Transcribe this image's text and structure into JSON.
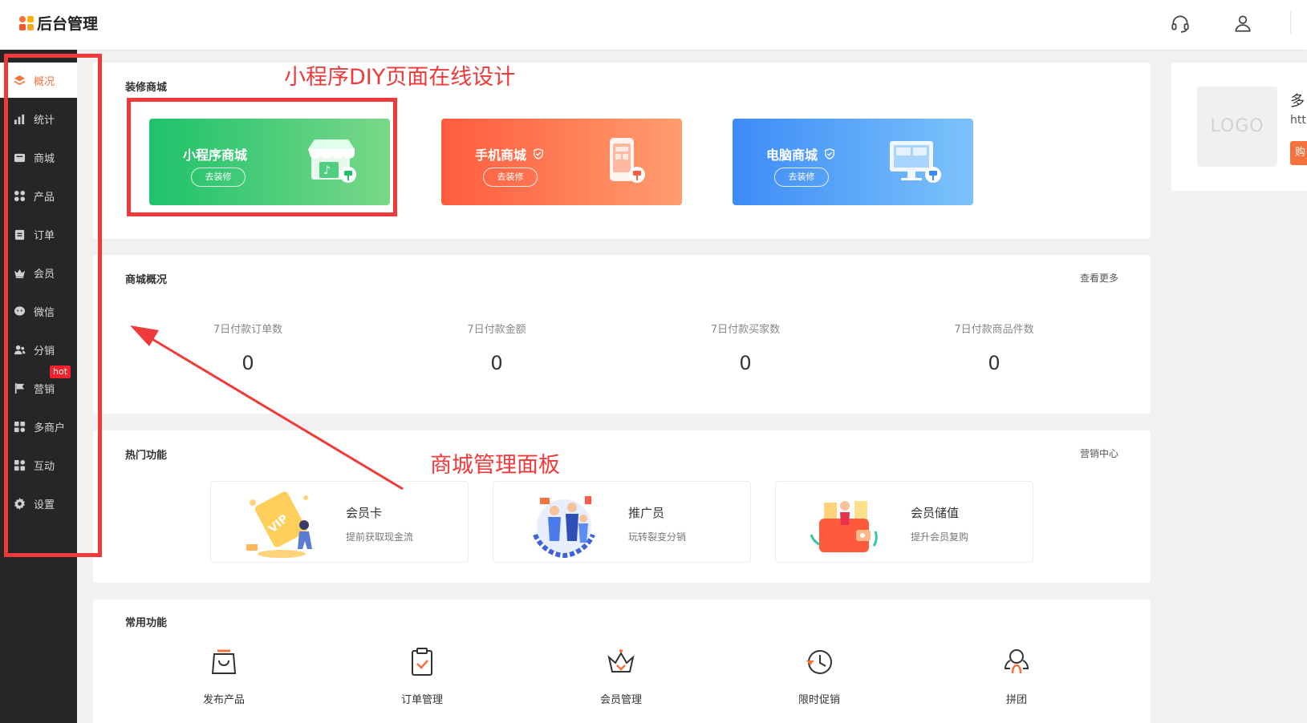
{
  "header": {
    "title": "后台管理",
    "logo_colors": [
      "#f5723c",
      "#f5a623",
      "#f05a28",
      "#ffb000"
    ],
    "icons": [
      "headset-icon",
      "user-icon"
    ]
  },
  "sidebar": {
    "items": [
      {
        "label": "概况",
        "icon": "layers-icon",
        "active": true
      },
      {
        "label": "统计",
        "icon": "bar-chart-icon"
      },
      {
        "label": "商城",
        "icon": "store-icon"
      },
      {
        "label": "产品",
        "icon": "grid-icon"
      },
      {
        "label": "订单",
        "icon": "clipboard-icon"
      },
      {
        "label": "会员",
        "icon": "crown-icon"
      },
      {
        "label": "微信",
        "icon": "chat-icon"
      },
      {
        "label": "分销",
        "icon": "users-icon"
      },
      {
        "label": "营销",
        "icon": "flag-icon"
      },
      {
        "label": "多商户",
        "icon": "merchant-icon"
      },
      {
        "label": "互动",
        "icon": "interact-icon"
      },
      {
        "label": "设置",
        "icon": "gear-icon"
      }
    ],
    "hot_badge": "hot",
    "active_color": "#f5723c"
  },
  "decorate": {
    "title": "装修商城",
    "cards": [
      {
        "name": "小程序商城",
        "button": "去装修",
        "verified": false,
        "gradient": [
          "#1ec26a",
          "#7ad88a"
        ]
      },
      {
        "name": "手机商城",
        "button": "去装修",
        "verified": true,
        "gradient": [
          "#ff5b3e",
          "#ff9d6e"
        ]
      },
      {
        "name": "电脑商城",
        "button": "去装修",
        "verified": true,
        "gradient": [
          "#3d8bf7",
          "#7cc3fb"
        ]
      }
    ]
  },
  "overview": {
    "title": "商城概况",
    "more": "查看更多",
    "stats": [
      {
        "label": "7日付款订单数",
        "value": "0"
      },
      {
        "label": "7日付款金额",
        "value": "0"
      },
      {
        "label": "7日付款买家数",
        "value": "0"
      },
      {
        "label": "7日付款商品件数",
        "value": "0"
      }
    ]
  },
  "hot": {
    "title": "热门功能",
    "more": "营销中心",
    "cards": [
      {
        "name": "会员卡",
        "desc": "提前获取现金流"
      },
      {
        "name": "推广员",
        "desc": "玩转裂变分销"
      },
      {
        "name": "会员储值",
        "desc": "提升会员复购"
      }
    ]
  },
  "common": {
    "title": "常用功能",
    "items": [
      {
        "label": "发布产品",
        "icon": "shopping-bag-icon"
      },
      {
        "label": "订单管理",
        "icon": "order-check-icon"
      },
      {
        "label": "会员管理",
        "icon": "crown-icon"
      },
      {
        "label": "限时促销",
        "icon": "clock-icon"
      },
      {
        "label": "拼团",
        "icon": "group-icon"
      }
    ]
  },
  "shop": {
    "logo_text": "LOGO",
    "name_partial": "多",
    "url_partial": "http",
    "button_partial": "购"
  },
  "annotations": {
    "top_label": "小程序DIY页面在线设计",
    "mid_label": "商城管理面板",
    "color": "#f03a3a"
  }
}
